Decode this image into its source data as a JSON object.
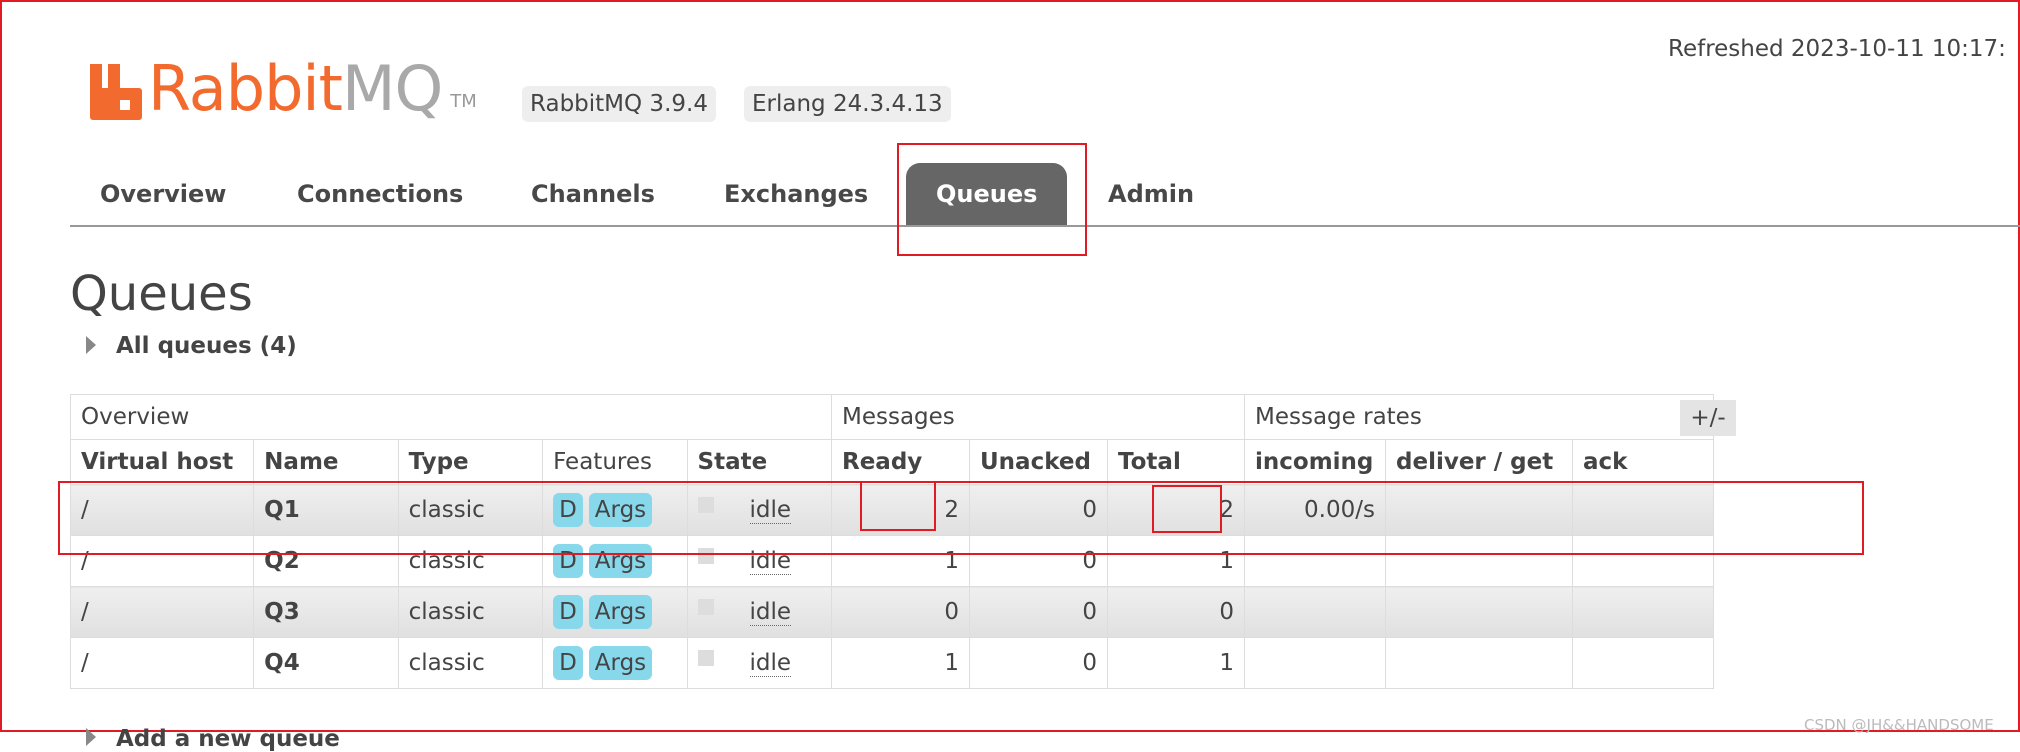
{
  "header": {
    "logo_rabbit": "Rabbit",
    "logo_mq": "MQ",
    "logo_tm": "TM",
    "version_rabbitmq": "RabbitMQ 3.9.4",
    "version_erlang": "Erlang 24.3.4.13",
    "refreshed": "Refreshed 2023-10-11 10:17:",
    "brand_color": "#f26a2d"
  },
  "tabs": [
    {
      "label": "Overview",
      "active": false
    },
    {
      "label": "Connections",
      "active": false
    },
    {
      "label": "Channels",
      "active": false
    },
    {
      "label": "Exchanges",
      "active": false
    },
    {
      "label": "Queues",
      "active": true
    },
    {
      "label": "Admin",
      "active": false
    }
  ],
  "page": {
    "title": "Queues",
    "all_queues_label": "All queues (4)",
    "add_queue_label": "Add a new queue",
    "plus_minus": "+/-",
    "watermark": "CSDN @JH&&HANDSOME"
  },
  "table": {
    "group_headers": [
      "Overview",
      "Messages",
      "Message rates"
    ],
    "columns": [
      "Virtual host",
      "Name",
      "Type",
      "Features",
      "State",
      "Ready",
      "Unacked",
      "Total",
      "incoming",
      "deliver / get",
      "ack"
    ],
    "rows": [
      {
        "vhost": "/",
        "name": "Q1",
        "type": "classic",
        "feat_d": "D",
        "feat_args": "Args",
        "state": "idle",
        "ready": "2",
        "unacked": "0",
        "total": "2",
        "incoming": "0.00/s",
        "deliver_get": "",
        "ack": ""
      },
      {
        "vhost": "/",
        "name": "Q2",
        "type": "classic",
        "feat_d": "D",
        "feat_args": "Args",
        "state": "idle",
        "ready": "1",
        "unacked": "0",
        "total": "1",
        "incoming": "",
        "deliver_get": "",
        "ack": ""
      },
      {
        "vhost": "/",
        "name": "Q3",
        "type": "classic",
        "feat_d": "D",
        "feat_args": "Args",
        "state": "idle",
        "ready": "0",
        "unacked": "0",
        "total": "0",
        "incoming": "",
        "deliver_get": "",
        "ack": ""
      },
      {
        "vhost": "/",
        "name": "Q4",
        "type": "classic",
        "feat_d": "D",
        "feat_args": "Args",
        "state": "idle",
        "ready": "1",
        "unacked": "0",
        "total": "1",
        "incoming": "",
        "deliver_get": "",
        "ack": ""
      }
    ]
  }
}
